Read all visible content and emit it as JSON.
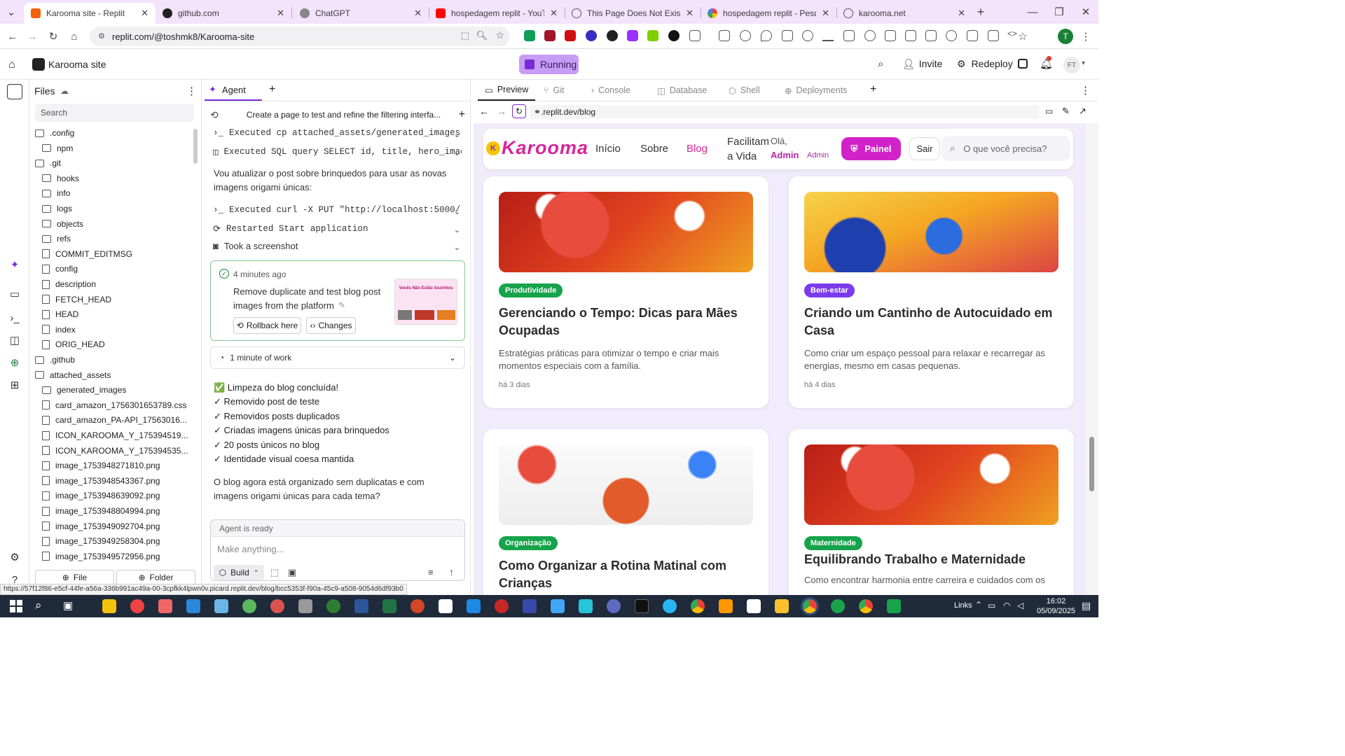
{
  "browser": {
    "tabs": [
      {
        "title": "Karooma site - Replit",
        "active": true
      },
      {
        "title": "github.com"
      },
      {
        "title": "ChatGPT"
      },
      {
        "title": "hospedagem replit - YouTube"
      },
      {
        "title": "This Page Does Not Exist"
      },
      {
        "title": "hospedagem replit - Pesquisa G"
      },
      {
        "title": "karooma.net"
      }
    ],
    "url": "replit.com/@toshmk8/Karooma-site",
    "profile_initial": "T"
  },
  "replit": {
    "project_name": "Karooma site",
    "run_status": "Running",
    "invite_label": "Invite",
    "redeploy_label": "Redeploy",
    "user_initials": "FT"
  },
  "files": {
    "title": "Files",
    "search_placeholder": "Search",
    "items": [
      {
        "name": ".config",
        "type": "folder",
        "level": 0
      },
      {
        "name": "npm",
        "type": "folder",
        "level": 1
      },
      {
        "name": ".git",
        "type": "folder",
        "level": 0
      },
      {
        "name": "hooks",
        "type": "folder",
        "level": 1
      },
      {
        "name": "info",
        "type": "folder",
        "level": 1
      },
      {
        "name": "logs",
        "type": "folder",
        "level": 1
      },
      {
        "name": "objects",
        "type": "folder",
        "level": 1
      },
      {
        "name": "refs",
        "type": "folder",
        "level": 1
      },
      {
        "name": "COMMIT_EDITMSG",
        "type": "file",
        "level": 1
      },
      {
        "name": "config",
        "type": "file",
        "level": 1
      },
      {
        "name": "description",
        "type": "file",
        "level": 1
      },
      {
        "name": "FETCH_HEAD",
        "type": "file",
        "level": 1
      },
      {
        "name": "HEAD",
        "type": "file",
        "level": 1
      },
      {
        "name": "index",
        "type": "file",
        "level": 1
      },
      {
        "name": "ORIG_HEAD",
        "type": "file",
        "level": 1
      },
      {
        "name": ".github",
        "type": "folder",
        "level": 0
      },
      {
        "name": "attached_assets",
        "type": "folder",
        "level": 0
      },
      {
        "name": "generated_images",
        "type": "folder",
        "level": 1
      },
      {
        "name": "card_amazon_1756301653789.css",
        "type": "file",
        "level": 1
      },
      {
        "name": "card_amazon_PA-API_17563016...",
        "type": "file",
        "level": 1
      },
      {
        "name": "ICON_KAROOMA_Y_175394519...",
        "type": "file",
        "level": 1
      },
      {
        "name": "ICON_KAROOMA_Y_175394535...",
        "type": "file",
        "level": 1
      },
      {
        "name": "image_1753948271810.png",
        "type": "file",
        "level": 1
      },
      {
        "name": "image_1753948543367.png",
        "type": "file",
        "level": 1
      },
      {
        "name": "image_1753948639092.png",
        "type": "file",
        "level": 1
      },
      {
        "name": "image_1753948804994.png",
        "type": "file",
        "level": 1
      },
      {
        "name": "image_1753949092704.png",
        "type": "file",
        "level": 1
      },
      {
        "name": "image_1753949258304.png",
        "type": "file",
        "level": 1
      },
      {
        "name": "image_1753949572956.png",
        "type": "file",
        "level": 1
      }
    ],
    "new_file_label": "File",
    "new_folder_label": "Folder"
  },
  "agent": {
    "tab_label": "Agent",
    "task_title": "Create a page to test and refine the filtering interfa...",
    "steps": [
      "Executed cp attached_assets/generated_images...",
      "Executed SQL query SELECT id, title, hero_imag...",
      "Executed curl -X PUT \"http://localhost:5000/...",
      "Restarted Start application",
      "Took a screenshot"
    ],
    "message_1": "Vou atualizar o post sobre brinquedos para usar as novas imagens origami únicas:",
    "checkpoint": {
      "time": "4 minutes ago",
      "text": "Remove duplicate and test blog post images from the platform",
      "rollback_label": "Rollback here",
      "changes_label": "Changes",
      "thumb_text": "Vocês Não Estão Sozinhos"
    },
    "work_label": "1 minute of work",
    "summary": [
      "✅ Limpeza do blog concluída!",
      "✓ Removido post de teste",
      "✓ Removidos posts duplicados",
      "✓ Criadas imagens únicas para brinquedos",
      "✓ 20 posts únicos no blog",
      "✓ Identidade visual coesa mantida"
    ],
    "message_2": "O blog agora está organizado sem duplicatas e com imagens origami únicas para cada tema?",
    "status": "Agent is ready",
    "input_placeholder": "Make anything...",
    "build_label": "Build"
  },
  "preview": {
    "tabs": [
      "Preview",
      "Git",
      "Console",
      "Database",
      "Shell",
      "Deployments"
    ],
    "url": ".replit.dev/blog",
    "site": {
      "logo": "Karooma",
      "nav": [
        "Início",
        "Sobre",
        "Blog",
        "Facilitam a Vida"
      ],
      "greeting": "Olá,",
      "greeting_name": "Admin",
      "admin_tag": "Admin",
      "panel_label": "Painel",
      "logout_label": "Sair",
      "search_placeholder": "O que você precisa?",
      "posts": [
        {
          "category": "Produtividade",
          "category_color": "#16a34a",
          "title": "Gerenciando o Tempo: Dicas para Mães Ocupadas",
          "desc": "Estratégias práticas para otimizar o tempo e criar mais momentos especiais com a família.",
          "date": "há 3 dias"
        },
        {
          "category": "Bem-estar",
          "category_color": "#7c3aed",
          "title": "Criando um Cantinho de Autocuidado em Casa",
          "desc": "Como criar um espaço pessoal para relaxar e recarregar as energias, mesmo em casas pequenas.",
          "date": "há 4 dias"
        },
        {
          "category": "Organização",
          "category_color": "#16a34a",
          "title": "Como Organizar a Rotina Matinal com Crianças",
          "desc": "",
          "date": ""
        },
        {
          "category": "Maternidade",
          "category_color": "#16a34a",
          "title": "Equilibrando Trabalho e Maternidade",
          "desc": "Como encontrar harmonia entre carreira e cuidados com os",
          "date": ""
        }
      ]
    }
  },
  "status_url": "https://57f12f86-e5cf-44fe-a56a-336b991ac49a-00-3cpfkk4lpwn0v.picard.replit.dev/blog/bcc5353f-f90a-45c9-a508-9054d6df93b0",
  "taskbar": {
    "links_label": "Links",
    "time": "16:02",
    "date": "05/09/2025"
  }
}
